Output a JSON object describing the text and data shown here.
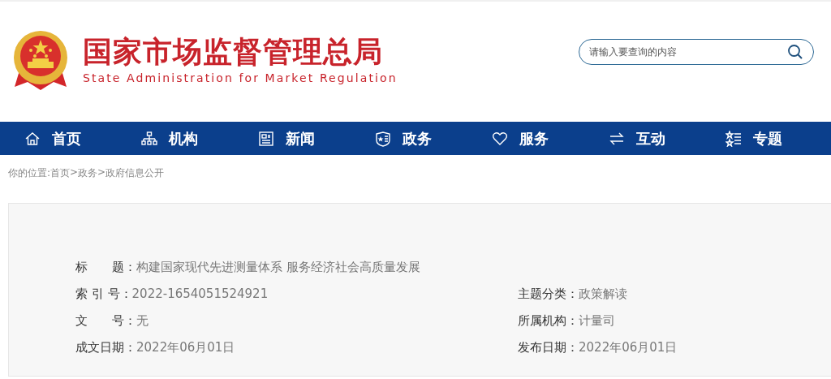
{
  "header": {
    "title": "国家市场监督管理总局",
    "subtitle": "State Administration for Market Regulation",
    "search": {
      "placeholder": "请输入要查询的内容"
    }
  },
  "nav": [
    {
      "label": "首页"
    },
    {
      "label": "机构"
    },
    {
      "label": "新闻"
    },
    {
      "label": "政务"
    },
    {
      "label": "服务"
    },
    {
      "label": "互动"
    },
    {
      "label": "专题"
    }
  ],
  "breadcrumb": {
    "prefix": "你的位置:",
    "items": [
      "首页",
      "政务",
      "政府信息公开"
    ],
    "separator": ">"
  },
  "info": {
    "rows": [
      [
        {
          "label": "标　　题：",
          "value": "构建国家现代先进测量体系 服务经济社会高质量发展"
        }
      ],
      [
        {
          "label": "索 引 号：",
          "value": "2022-1654051524921"
        },
        {
          "label": "主题分类：",
          "value": "政策解读"
        }
      ],
      [
        {
          "label": "文　　号：",
          "value": "无"
        },
        {
          "label": "所属机构：",
          "value": "计量司"
        }
      ],
      [
        {
          "label": "成文日期：",
          "value": "2022年06月01日"
        },
        {
          "label": "发布日期：",
          "value": "2022年06月01日"
        }
      ]
    ]
  }
}
